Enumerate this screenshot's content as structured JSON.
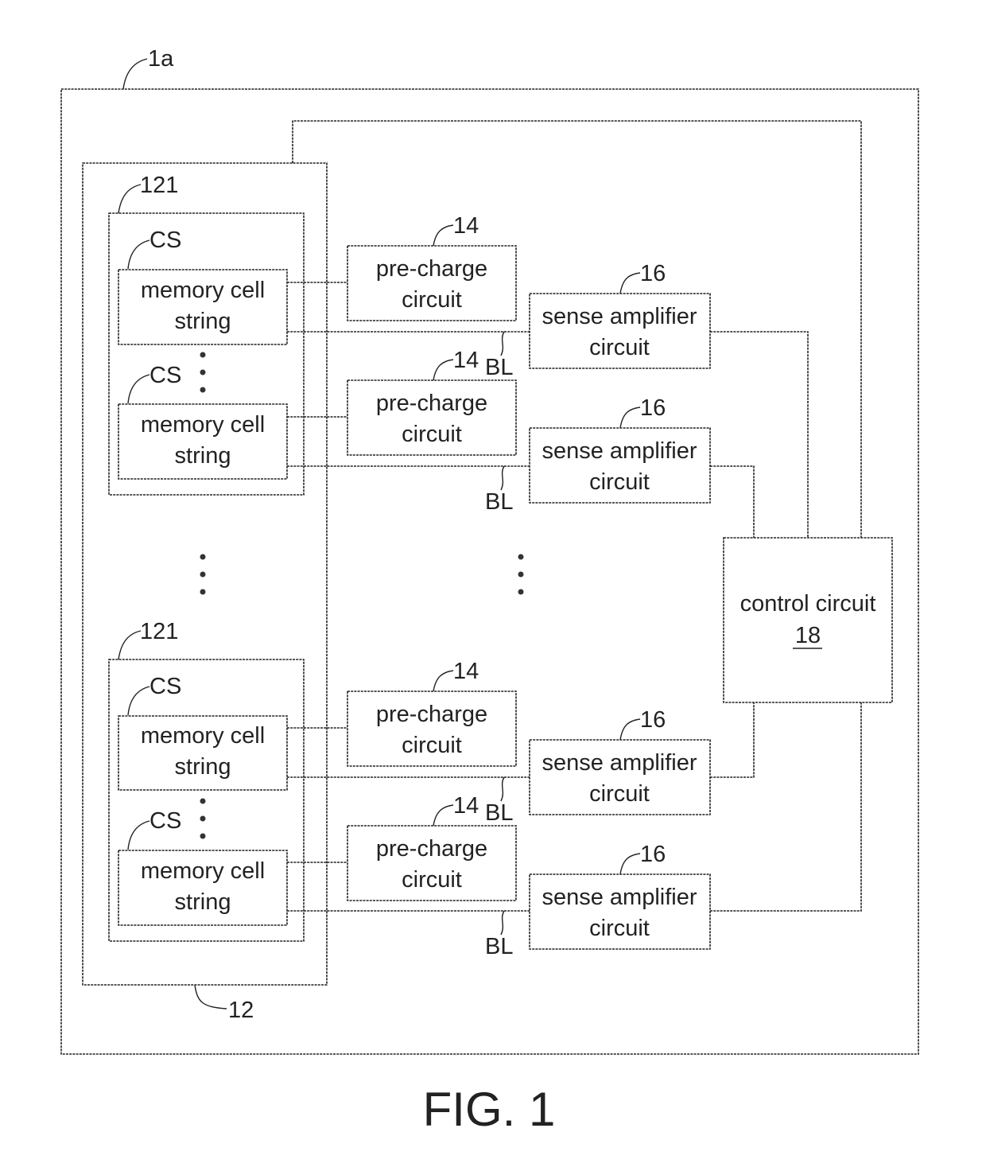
{
  "figure_label": "FIG. 1",
  "refs": {
    "device": "1a",
    "array": "12",
    "block": "121",
    "cell_string": "CS",
    "precharge": "14",
    "sense_amp": "16",
    "bitline": "BL"
  },
  "labels": {
    "memory_cell_line1": "memory cell",
    "memory_cell_line2": "string",
    "precharge_line1": "pre-charge",
    "precharge_line2": "circuit",
    "sense_line1": "sense amplifier",
    "sense_line2": "circuit",
    "control_line1": "control circuit",
    "control_ref": "18"
  }
}
